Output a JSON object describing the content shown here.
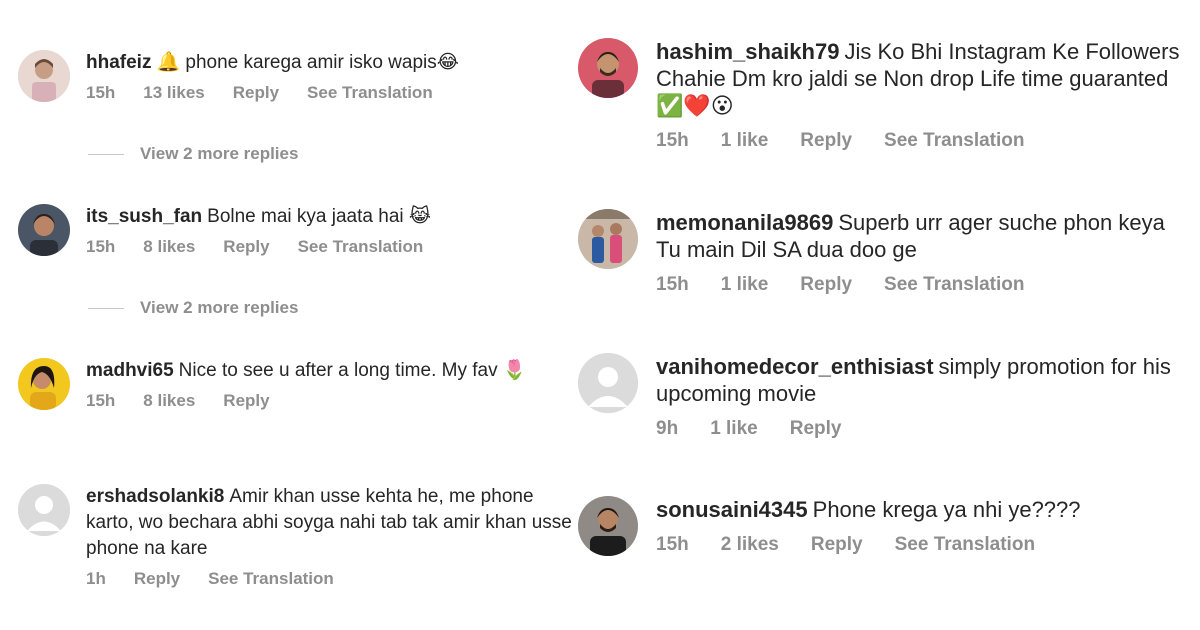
{
  "left_comments": [
    {
      "username": "hhafeiz",
      "text": "🔔 phone karega amir isko wapis😂",
      "time": "15h",
      "likes": "13 likes",
      "reply": "Reply",
      "translate": "See Translation",
      "avatar": "avatar-photo-person",
      "more_replies": "View 2 more replies"
    },
    {
      "username": "its_sush_fan",
      "text": "Bolne mai kya jaata hai 😹",
      "time": "15h",
      "likes": "8 likes",
      "reply": "Reply",
      "translate": "See Translation",
      "avatar": "avatar-photo-man",
      "more_replies": "View 2 more replies"
    },
    {
      "username": "madhvi65",
      "text": "Nice to see u after a long time. My fav 🌷",
      "time": "15h",
      "likes": "8 likes",
      "reply": "Reply",
      "avatar": "avatar-photo-woman"
    },
    {
      "username": "ershadsolanki8",
      "text": "Amir khan usse kehta he, me phone karto, wo bechara abhi soyga nahi tab tak amir khan usse phone na kare",
      "time": "1h",
      "reply": "Reply",
      "translate": "See Translation",
      "avatar": "default-avatar-icon"
    }
  ],
  "right_comments": [
    {
      "username": "hashim_shaikh79",
      "text": "Jis Ko Bhi Instagram Ke Followers Chahie Dm kro jaldi se Non drop Life time guaranted ✅❤️😮",
      "time": "15h",
      "likes": "1 like",
      "reply": "Reply",
      "translate": "See Translation",
      "avatar": "avatar-photo-man"
    },
    {
      "username": "memonanila9869",
      "text": "Superb urr ager suche phon keya Tu main Dil SA dua doo ge",
      "time": "15h",
      "likes": "1 like",
      "reply": "Reply",
      "translate": "See Translation",
      "avatar": "avatar-photo-group"
    },
    {
      "username": "vanihomedecor_enthisiast",
      "text": "simply promotion for his upcoming movie",
      "time": "9h",
      "likes": "1 like",
      "reply": "Reply",
      "avatar": "default-avatar-icon"
    },
    {
      "username": "sonusaini4345",
      "text": "Phone krega ya nhi ye????",
      "time": "15h",
      "likes": "2 likes",
      "reply": "Reply",
      "translate": "See Translation",
      "avatar": "avatar-photo-man"
    }
  ],
  "colors": {
    "text": "#262626",
    "meta": "#8e8e8e",
    "divider": "#c7c7c7",
    "default_avatar_bg": "#dbdbdb"
  }
}
